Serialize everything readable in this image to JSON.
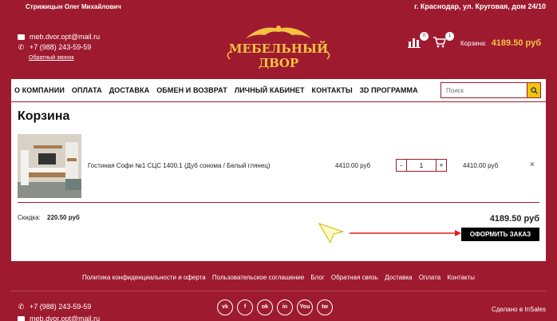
{
  "topbar": {
    "user": "Стрижицын Олег Михайлович",
    "address": "г. Краснодар, ул. Круговая, дом 24/10"
  },
  "contacts": {
    "email": "meb.dvor.opt@mail.ru",
    "phone": "+7 (988) 243-59-59",
    "callback": "Обратный звонок"
  },
  "logo": {
    "line1": "МЕБЕЛЬНЫЙ",
    "line2": "ДВОР"
  },
  "header": {
    "compare_count": "0",
    "cart_count": "1",
    "cart_label": "Корзина:",
    "cart_total": "4189.50 руб"
  },
  "nav": {
    "items": [
      "О КОМПАНИИ",
      "ОПЛАТА",
      "ДОСТАВКА",
      "ОБМЕН И ВОЗВРАТ",
      "ЛИЧНЫЙ КАБИНЕТ",
      "КОНТАКТЫ",
      "3D ПРОГРАММА"
    ],
    "search_placeholder": "Поиск"
  },
  "cart": {
    "title": "Корзина",
    "item": {
      "name": "Гостиная Софи №1 СЦС 1400.1 (Дуб сонома / Белый глянец)",
      "price": "4410.00 руб",
      "qty": "1",
      "sum": "4410.00 руб",
      "minus": "-",
      "plus": "+",
      "remove": "×"
    },
    "discount_label": "Скидка:",
    "discount_value": "220.50 руб",
    "total": "4189.50 руб",
    "order_button": "ОФОРМИТЬ ЗАКАЗ"
  },
  "footer": {
    "links": [
      "Политика конфиденциальности и оферта",
      "Пользовательское соглашение",
      "Блог",
      "Обратная связь",
      "Доставка",
      "Оплата",
      "Контакты"
    ],
    "phone": "+7 (988) 243-59-59",
    "email": "meb.dvor.opt@mail.ru",
    "socials": [
      "vk",
      "f",
      "ok",
      "in",
      "You",
      "tw"
    ],
    "made_by": "Сделано в InSales"
  },
  "colors": {
    "brand": "#9e1b2f",
    "accent": "#f5c242",
    "button": "#000000"
  }
}
